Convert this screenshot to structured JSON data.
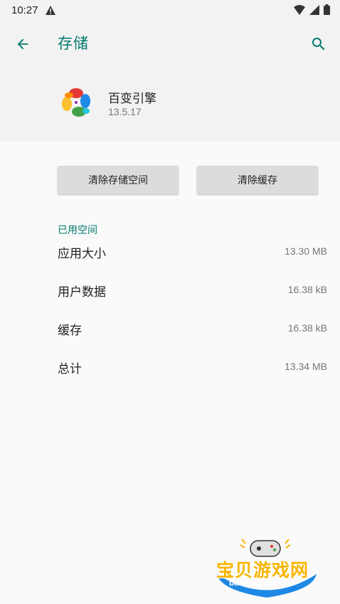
{
  "status_bar": {
    "time": "10:27",
    "icons": [
      "warning-icon",
      "wifi-icon",
      "signal-icon",
      "battery-icon"
    ]
  },
  "toolbar": {
    "title": "存储",
    "back_icon": "arrow-back-icon",
    "search_icon": "search-icon"
  },
  "app": {
    "name": "百变引擎",
    "version": "13.5.17"
  },
  "buttons": {
    "clear_storage": "清除存储空间",
    "clear_cache": "清除缓存"
  },
  "storage": {
    "section_title": "已用空间",
    "rows": [
      {
        "label": "应用大小",
        "value": "13.30 MB"
      },
      {
        "label": "用户数据",
        "value": "16.38 kB"
      },
      {
        "label": "缓存",
        "value": "16.38 kB"
      },
      {
        "label": "总计",
        "value": "13.34 MB"
      }
    ]
  },
  "watermark": {
    "text": "宝贝游戏网",
    "url": "baobeiy.com"
  },
  "colors": {
    "accent": "#00796b",
    "header_bg": "#f2f2f2",
    "button_bg": "#dcdcdc"
  }
}
